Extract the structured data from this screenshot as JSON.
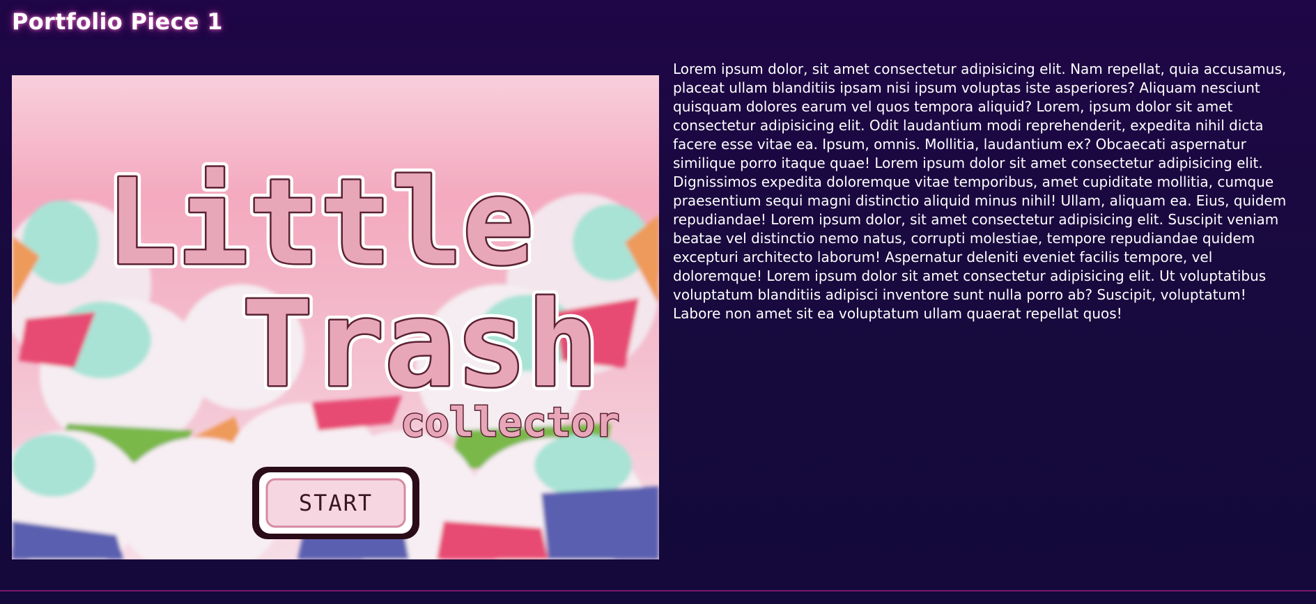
{
  "page": {
    "title": "Portfolio Piece 1",
    "description": "Lorem ipsum dolor, sit amet consectetur adipisicing elit. Nam repellat, quia accusamus, placeat ullam blanditiis ipsam nisi ipsum voluptas iste asperiores? Aliquam nesciunt quisquam dolores earum vel quos tempora aliquid? Lorem, ipsum dolor sit amet consectetur adipisicing elit. Odit laudantium modi reprehenderit, expedita nihil dicta facere esse vitae ea. Ipsum, omnis. Mollitia, laudantium ex? Obcaecati aspernatur similique porro itaque quae! Lorem ipsum dolor sit amet consectetur adipisicing elit. Dignissimos expedita doloremque vitae temporibus, amet cupiditate mollitia, cumque praesentium sequi magni distinctio aliquid minus nihil! Ullam, aliquam ea. Eius, quidem repudiandae! Lorem ipsum dolor, sit amet consectetur adipisicing elit. Suscipit veniam beatae vel distinctio nemo natus, corrupti molestiae, tempore repudiandae quidem excepturi architecto laborum! Aspernatur deleniti eveniet facilis tempore, vel doloremque! Lorem ipsum dolor sit amet consectetur adipisicing elit. Ut voluptatibus voluptatum blanditiis adipisci inventore sunt nulla porro ab? Suscipit, voluptatum! Labore non amet sit ea voluptatum ullam quaerat repellat quos!"
  },
  "game_screenshot": {
    "logo_line1": "Little",
    "logo_line2": "Trash",
    "logo_line3": "collector",
    "start_label": "START"
  },
  "colors": {
    "background": "#1f0646",
    "title_glow": "#ff78d2",
    "footer_line": "#7b1a6d",
    "logo_fill": "#e8a7b9",
    "logo_outline": "#5a2233",
    "bag_mint": "#a9e3d6"
  }
}
